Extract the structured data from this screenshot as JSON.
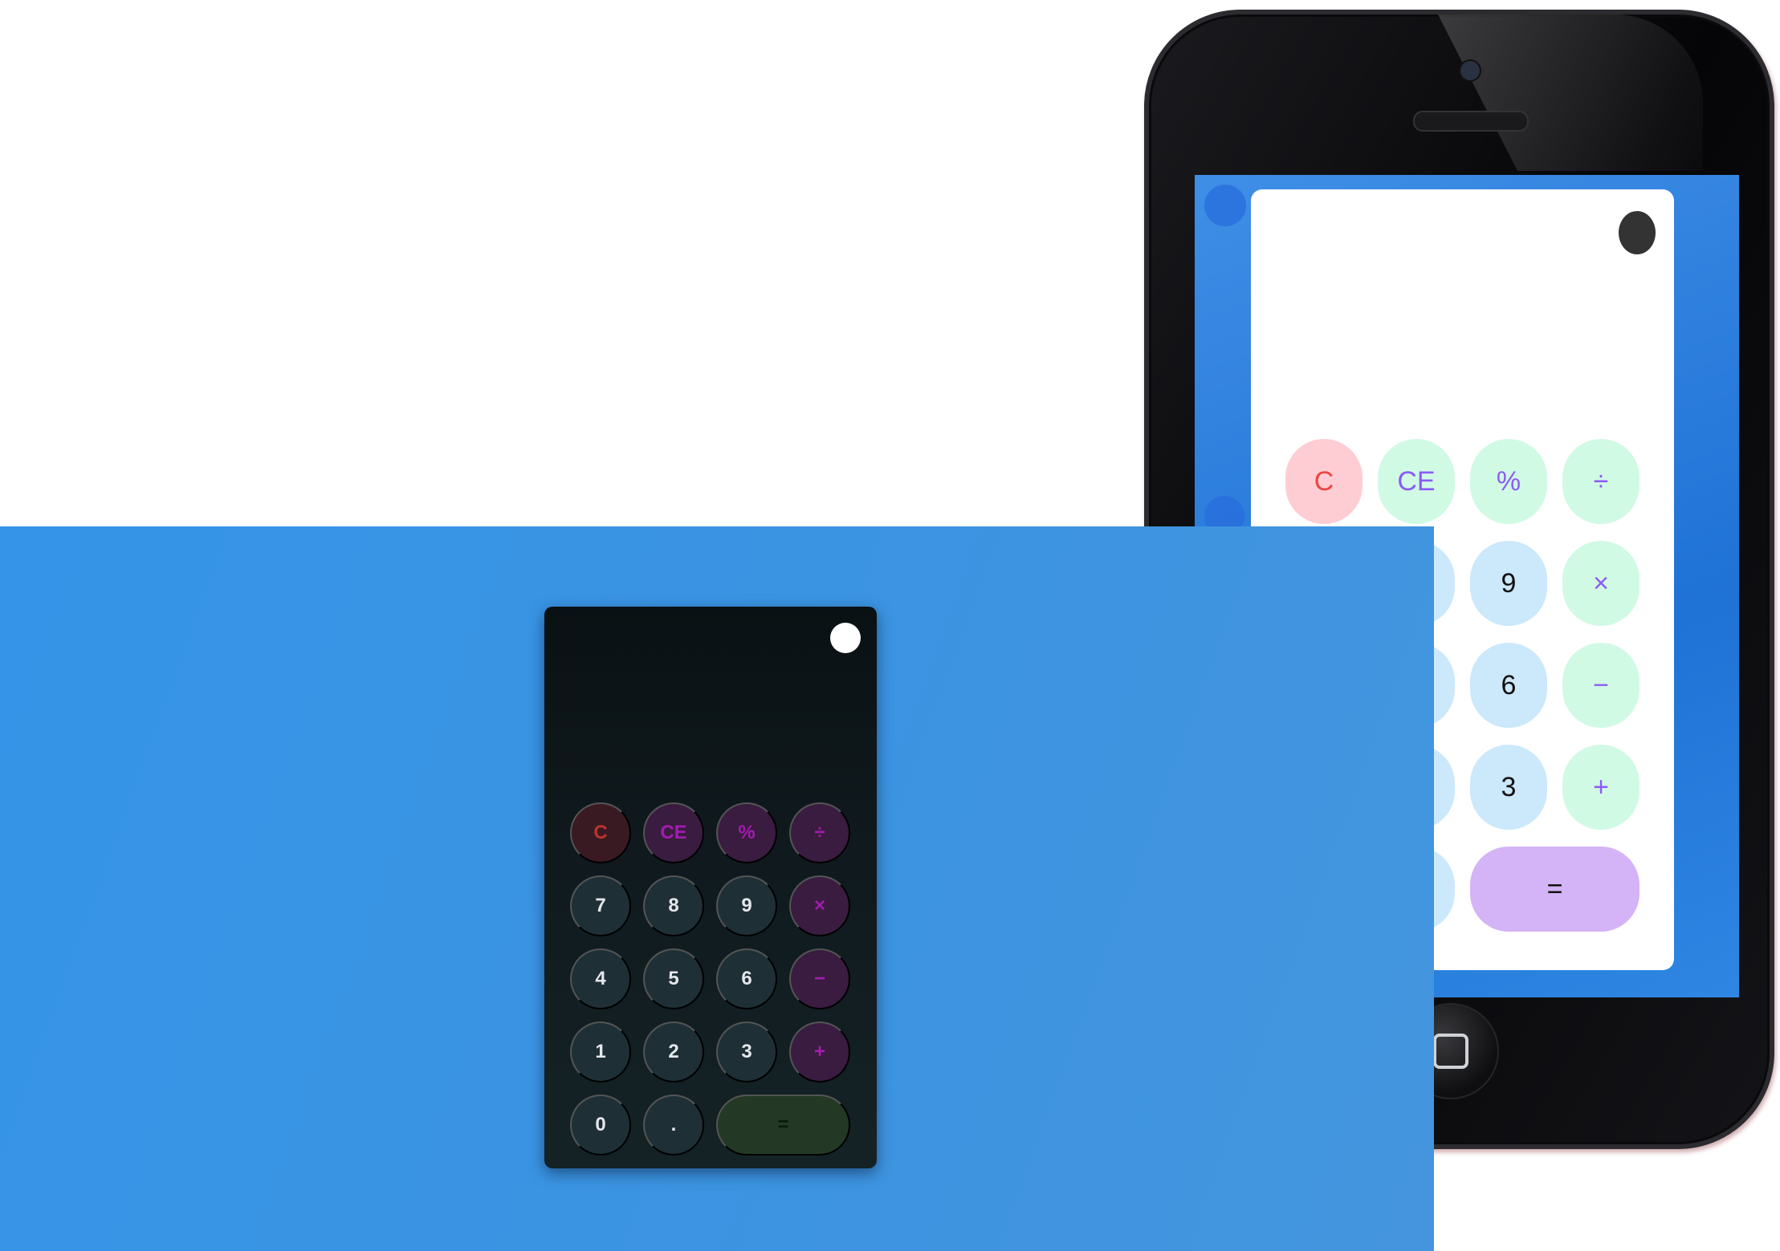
{
  "light_calculator": {
    "buttons": [
      "C",
      "CE",
      "%",
      "÷",
      "9",
      "×",
      "6",
      "−",
      "3",
      "+",
      "="
    ]
  },
  "dark_calculator": {
    "buttons": [
      "C",
      "CE",
      "%",
      "÷",
      "7",
      "8",
      "9",
      "×",
      "4",
      "5",
      "6",
      "−",
      "1",
      "2",
      "3",
      "+",
      "0",
      ".",
      "="
    ]
  },
  "colors": {
    "background_blue": "#3594e8",
    "light_clear": "#fecdd3",
    "light_operator": "#d1fae5",
    "light_number": "#cce8fb",
    "light_equals": "#d4b3f6",
    "dark_body": "#0a1114",
    "dark_number": "#1e3036",
    "dark_operator": "#3a1c40",
    "dark_equals": "#233925"
  }
}
